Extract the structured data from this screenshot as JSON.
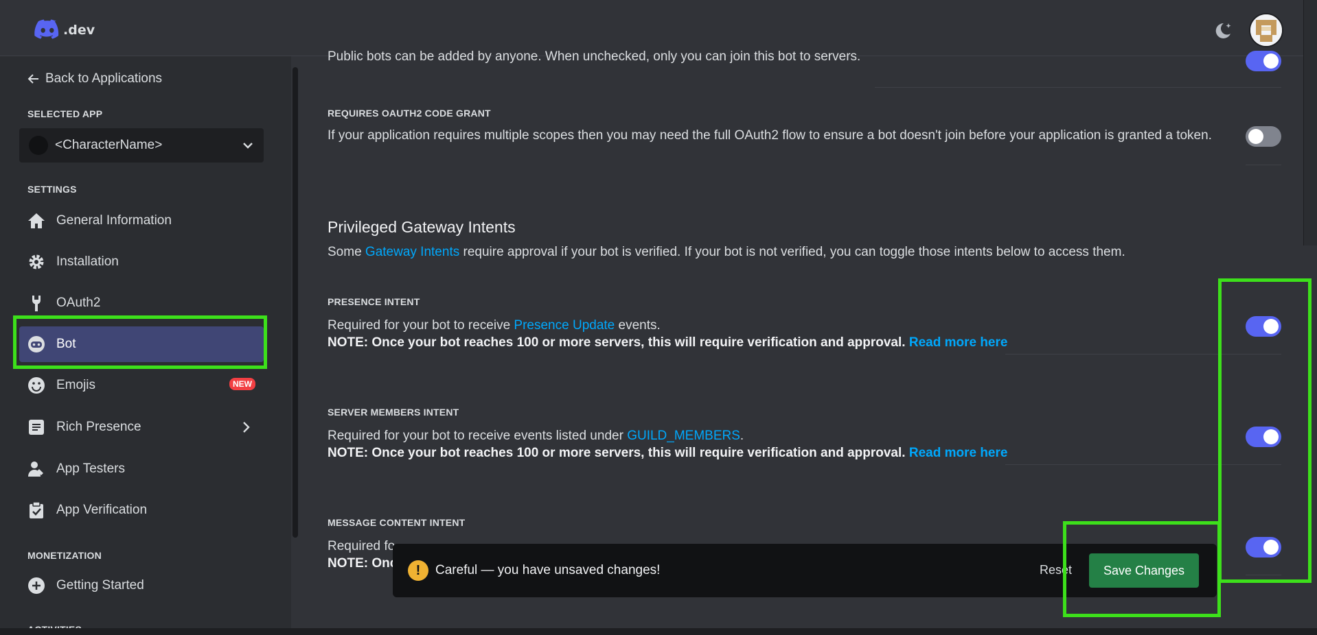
{
  "header": {
    "logo_text": ".dev"
  },
  "sidebar": {
    "back_label": "Back to Applications",
    "selected_app_label": "SELECTED APP",
    "selected_app_name": "<CharacterName>",
    "settings_label": "SETTINGS",
    "items": [
      {
        "label": "General Information",
        "icon": "home-icon"
      },
      {
        "label": "Installation",
        "icon": "gear-icon"
      },
      {
        "label": "OAuth2",
        "icon": "wrench-icon"
      },
      {
        "label": "Bot",
        "icon": "bot-icon",
        "active": true
      },
      {
        "label": "Emojis",
        "icon": "emoji-icon",
        "badge": "NEW"
      },
      {
        "label": "Rich Presence",
        "icon": "document-icon"
      },
      {
        "label": "App Testers",
        "icon": "person-icon"
      },
      {
        "label": "App Verification",
        "icon": "clipboard-check-icon"
      }
    ],
    "monetization_label": "MONETIZATION",
    "monetization_items": [
      {
        "label": "Getting Started",
        "icon": "plus-circle-icon"
      }
    ],
    "activities_label": "ACTIVITIES"
  },
  "main": {
    "public_bot_desc": "Public bots can be added by anyone. When unchecked, only you can join this bot to servers.",
    "oauth_grant_label": "REQUIRES OAUTH2 CODE GRANT",
    "oauth_grant_desc": "If your application requires multiple scopes then you may need the full OAuth2 flow to ensure a bot doesn't join before your application is granted a token.",
    "intents_title": "Privileged Gateway Intents",
    "intents_desc_pre": "Some ",
    "intents_desc_link": "Gateway Intents",
    "intents_desc_post": " require approval if your bot is verified. If your bot is not verified, you can toggle those intents below to access them.",
    "presence": {
      "label": "PRESENCE INTENT",
      "desc_pre": "Required for your bot to receive ",
      "desc_link": "Presence Update",
      "desc_post": " events.",
      "note": "NOTE: Once your bot reaches 100 or more servers, this will require verification and approval.",
      "read_more": "Read more here"
    },
    "members": {
      "label": "SERVER MEMBERS INTENT",
      "desc_pre": "Required for your bot to receive events listed under ",
      "desc_link": "GUILD_MEMBERS",
      "desc_post": ".",
      "note": "NOTE: Once your bot reaches 100 or more servers, this will require verification and approval.",
      "read_more": "Read more here"
    },
    "message": {
      "label": "MESSAGE CONTENT INTENT",
      "desc_pre": "Required fo",
      "note_pre": "NOTE: Onc"
    },
    "toggles": {
      "public_bot": true,
      "oauth_grant": false,
      "presence": true,
      "members": true,
      "message": true
    }
  },
  "unsaved_bar": {
    "message": "Careful — you have unsaved changes!",
    "reset_label": "Reset",
    "save_label": "Save Changes"
  },
  "colors": {
    "accent": "#5865f2",
    "save": "#248046",
    "highlight": "#3de01b",
    "link": "#00a8fc"
  }
}
